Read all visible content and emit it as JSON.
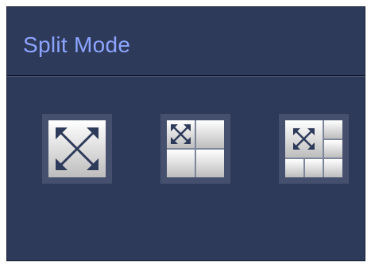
{
  "dialog": {
    "title": "Split Mode"
  },
  "split_modes": [
    {
      "id": "mode-1",
      "windows": 1,
      "icon": "fullscreen-arrows-icon"
    },
    {
      "id": "mode-4",
      "windows": 4,
      "icon": "grid-4-split-icon"
    },
    {
      "id": "mode-6",
      "windows": 6,
      "icon": "grid-6-split-icon"
    }
  ],
  "colors": {
    "panel_background": "#2e3a5a",
    "title_text": "#8da4ff",
    "tile_background": "#45506e",
    "arrow": "#2e3a5a"
  }
}
